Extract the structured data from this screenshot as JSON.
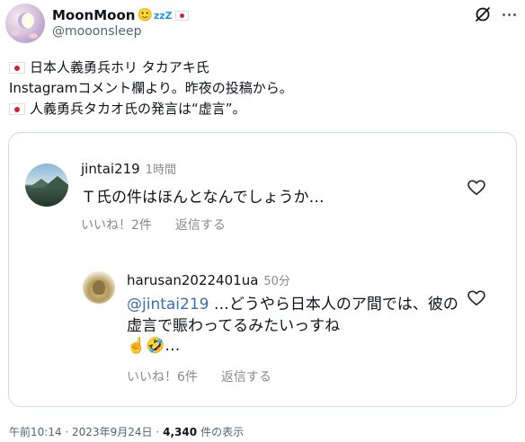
{
  "author": {
    "display_name": "MoonMoon",
    "name_emoji": "🙂",
    "name_zzz": "zzZ",
    "handle": "@mooonsleep"
  },
  "tweet": {
    "lines": [
      "日本人義勇兵ホリ タカアキ氏",
      "Instagramコメント欄より。昨夜の投稿から。",
      "人義勇兵タカオ氏の発言は“虚言”。"
    ]
  },
  "comments": {
    "first": {
      "username": "jintai219",
      "time": "1時間",
      "text": "Ｔ氏の件はほんとなんでしょうか…",
      "likes": "いいね！2件",
      "reply": "返信する"
    },
    "reply": {
      "username": "harusan2022401ua",
      "time": "50分",
      "mention": "@jintai219",
      "text": " …どうやら日本人のア間では、彼の虚言で賑わってるみたいっすね",
      "emoji": "☝️🤣…",
      "likes": "いいね！6件",
      "reply": "返信する"
    }
  },
  "meta": {
    "datetime": "午前10:14 · 2023年9月24日 ·",
    "views": "4,340",
    "views_label": "件の表示"
  },
  "colors": {
    "flag_red": "#d1242f",
    "mention_blue": "#3b6db3",
    "secondary_gray": "#536471"
  }
}
